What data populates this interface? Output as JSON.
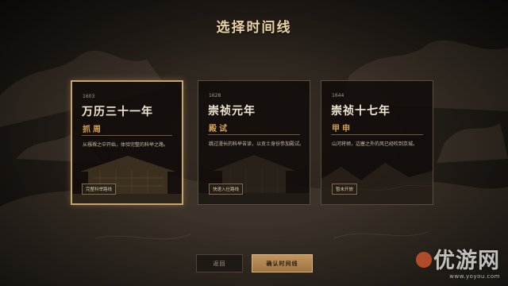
{
  "screen": {
    "title": "选择时间线"
  },
  "timelines": [
    {
      "year": "1603",
      "name": "万历三十一年",
      "subtitle": "抓周",
      "description": "从襁褓之中开始，体验完整的科举之路。",
      "tag": "完整科举路线",
      "selected": true
    },
    {
      "year": "1628",
      "name": "崇祯元年",
      "subtitle": "殿试",
      "description": "跳过漫长的科举苦读，以贡士身份参加殿试。",
      "tag": "快速入仕路线",
      "selected": false
    },
    {
      "year": "1644",
      "name": "崇祯十七年",
      "subtitle": "甲申",
      "description": "山河将倾，边塞之外的风已经吹到京城。",
      "tag": "暂未开放",
      "selected": false
    }
  ],
  "buttons": {
    "back": "返回",
    "confirm": "确认时间线"
  },
  "watermark": {
    "brand": "优游网",
    "url": "www.yoyou.com"
  },
  "colors": {
    "accent": "#c9a46b",
    "subtitle": "#d6a44e",
    "card_bg": "#100c09"
  },
  "icons": {
    "background": "landscape-painting-art",
    "card_art": "palace-illustration"
  }
}
